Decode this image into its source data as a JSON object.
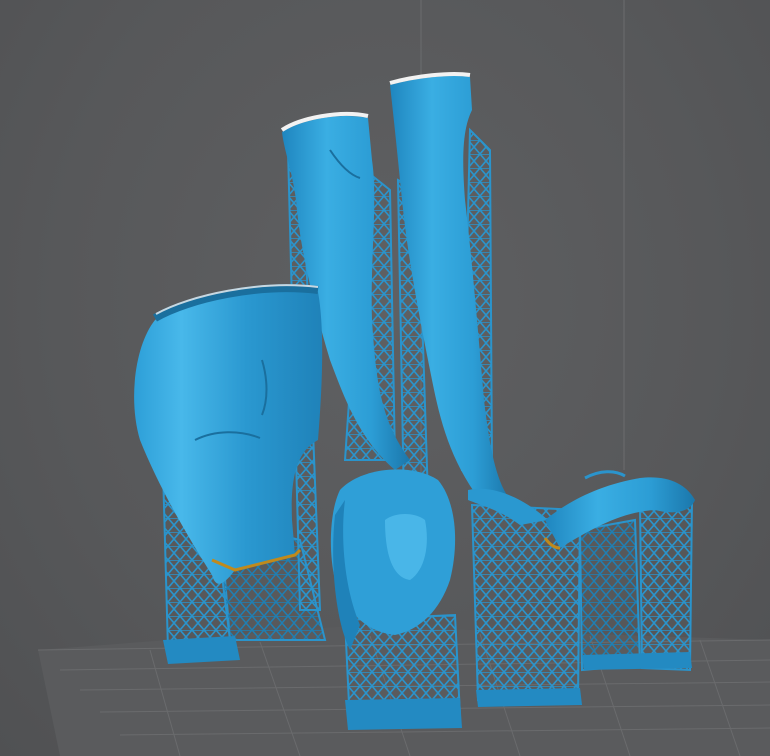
{
  "viewport": {
    "background_color": "#58595b",
    "grid_color": "#6b6c6e",
    "model_color": "#2e9fd6",
    "model_shadow_color": "#1a6f9e",
    "model_highlight_color": "#5cc4ef",
    "support_color": "#2a94cc",
    "edge_highlight_color": "#f2f2f2",
    "contact_point_color": "#c08a1c"
  },
  "model_parts": [
    "left-boot",
    "right-boot",
    "shorts-torso",
    "head",
    "hand-arm"
  ],
  "icons": {
    "build-plate": "build-plate-icon",
    "support-lattice": "lattice-support-icon"
  }
}
